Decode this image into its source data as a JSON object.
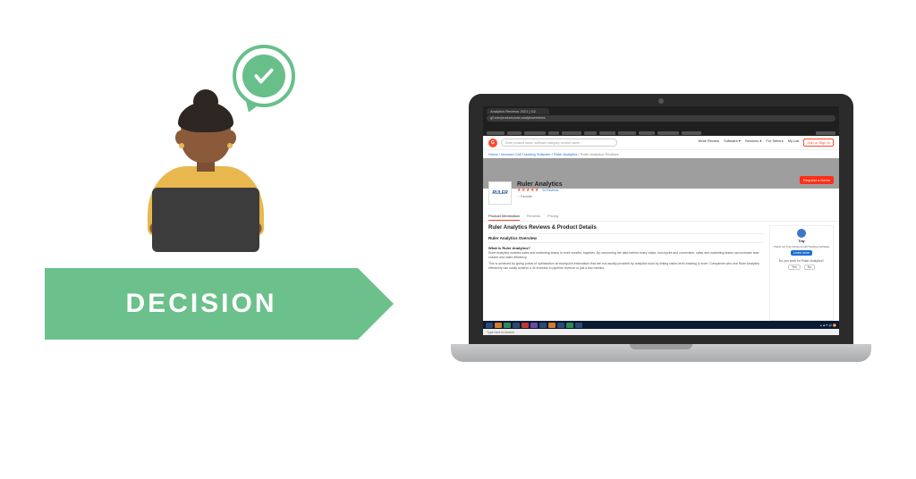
{
  "colors": {
    "banner_green": "#6cc08b",
    "check_green": "#68bf8a",
    "skin": "#8a5a3b",
    "shirt": "#e8b84f",
    "g2_orange": "#ff492c",
    "banner_text": "#ffffff"
  },
  "left": {
    "banner_label": "DECISION"
  },
  "browser": {
    "tab_title": "Analytics Reviews 2021 | G2",
    "url": "g2.com/products/ruler-analytics/reviews",
    "bookmarks": [
      "Marketing Tool",
      "RB Insider",
      "Profile, North Wales",
      "Gold",
      "All customers of",
      "Ideas",
      "WORKER",
      "Audio playback",
      "Monthly Lead",
      "How to Correct Me",
      "Marketing Report",
      "Other bookmarks"
    ]
  },
  "site": {
    "logo_letter": "G",
    "search_placeholder": "Enter product name, software category, service name...",
    "nav": {
      "write_review": "Write Review",
      "software": "Software ▾",
      "services": "Services ▾",
      "for_sellers": "For Sellers",
      "my_list": "My List",
      "signup": "Join or Sign In"
    },
    "breadcrumb": {
      "parts": [
        "Home",
        "Inbound Call Tracking Software",
        "Ruler Analytics"
      ],
      "current": "Ruler Analytics Reviews"
    },
    "product": {
      "logo_text": "RULER",
      "name": "Ruler Analytics",
      "stars": "★★★★★",
      "review_count": "94 Reviews",
      "favorite": "Favorite",
      "cta": "Request a Demo",
      "tabs": {
        "info": "Product Information",
        "reviews": "Reviews",
        "pricing": "Pricing"
      }
    },
    "content": {
      "heading": "Ruler Analytics Reviews & Product Details",
      "subheading": "Ruler Analytics Overview",
      "q1": "What is Ruler Analytics?",
      "p1": "Ruler Analytics enables sales and marketing teams to work smarter, together. By uncovering the data behind every visitor, touchpoint and conversion, sales and marketing teams can increase lead volume and sales efficiency.",
      "p2": "This is achieved by giving points of optimisation at touchpoint information that are not usually provided by analytics tools by linking visitor-level tracking & more. Companies who use Ruler Analytics effectively can easily achieve a 3x increase in pipeline revenue in just a few months."
    },
    "sidebar": {
      "partner_name": "Tray",
      "sub": "Check out Tray Inbound Call Tracking Software",
      "learn": "Learn more",
      "work_q": "Do you work for Ruler Analytics?",
      "yes": "Yes",
      "no": "No"
    }
  },
  "os": {
    "typing_hint": "Type here to search"
  }
}
